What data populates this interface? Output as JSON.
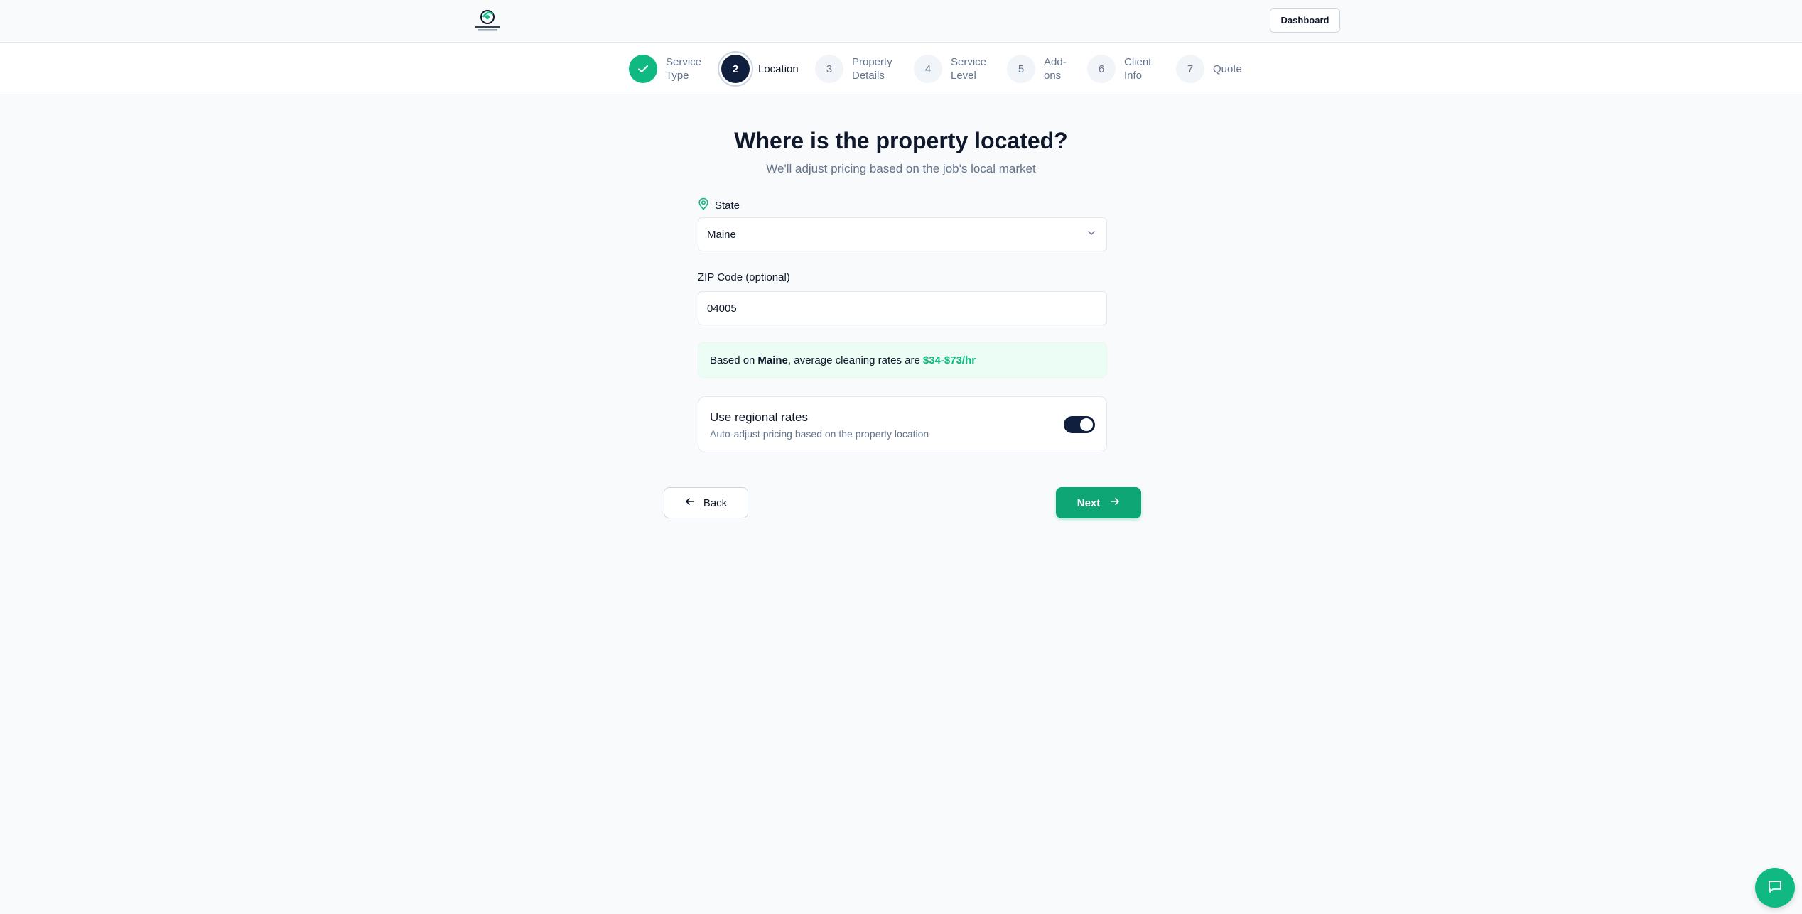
{
  "header": {
    "logo_icon": "company-logo",
    "dashboard_label": "Dashboard"
  },
  "stepper": {
    "steps": [
      {
        "number": "1",
        "label": "Service\nType",
        "status": "completed"
      },
      {
        "number": "2",
        "label": "Location",
        "status": "active"
      },
      {
        "number": "3",
        "label": "Property\nDetails",
        "status": "upcoming"
      },
      {
        "number": "4",
        "label": "Service\nLevel",
        "status": "upcoming"
      },
      {
        "number": "5",
        "label": "Add-\nons",
        "status": "upcoming"
      },
      {
        "number": "6",
        "label": "Client\nInfo",
        "status": "upcoming"
      },
      {
        "number": "7",
        "label": "Quote",
        "status": "upcoming"
      }
    ]
  },
  "main": {
    "title": "Where is the property located?",
    "subtitle": "We'll adjust pricing based on the job's local market",
    "state_label": "State",
    "state_value": "Maine",
    "zip_label": "ZIP Code (optional)",
    "zip_value": "04005",
    "info": {
      "prefix": "Based on",
      "state": "Maine",
      "middle": ", average cleaning rates are",
      "rate": "$34-$73/hr"
    },
    "regional_rates": {
      "title": "Use regional rates",
      "description": "Auto-adjust pricing based on the property location",
      "enabled": true
    }
  },
  "nav": {
    "back_label": "Back",
    "next_label": "Next"
  },
  "colors": {
    "accent_green": "#10b981",
    "navy": "#0f1f3d",
    "background": "#f8fafc"
  },
  "chat": {
    "icon": "chat-bubble-icon"
  }
}
